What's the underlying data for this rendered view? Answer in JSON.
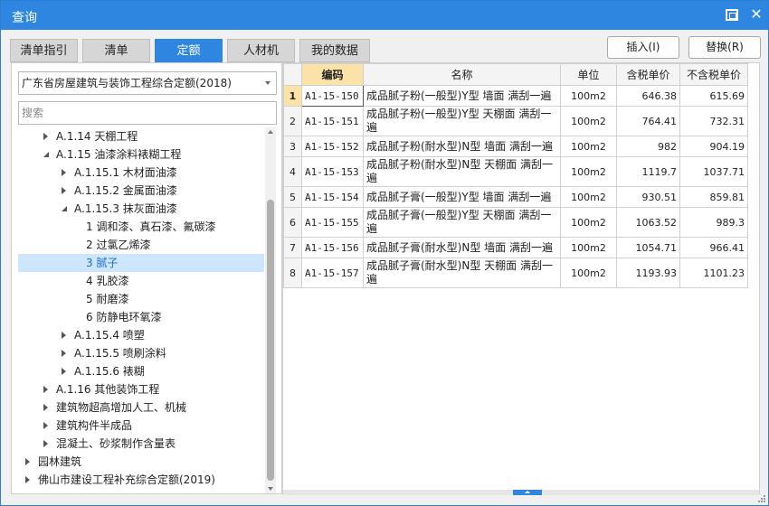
{
  "window": {
    "title": "查询"
  },
  "tabs": [
    {
      "label": "清单指引",
      "active": false
    },
    {
      "label": "清单",
      "active": false
    },
    {
      "label": "定额",
      "active": true
    },
    {
      "label": "人材机",
      "active": false
    },
    {
      "label": "我的数据",
      "active": false
    }
  ],
  "buttons": {
    "insert": "插入(I)",
    "replace": "替换(R)"
  },
  "quota_library": {
    "selected": "广东省房屋建筑与装饰工程综合定额(2018)"
  },
  "search": {
    "placeholder": "搜索",
    "value": ""
  },
  "tree": [
    {
      "label": "A.1.14 天棚工程",
      "level": 1,
      "toggle": "collapsed"
    },
    {
      "label": "A.1.15 油漆涂料裱糊工程",
      "level": 1,
      "toggle": "expanded"
    },
    {
      "label": "A.1.15.1 木材面油漆",
      "level": 2,
      "toggle": "collapsed"
    },
    {
      "label": "A.1.15.2 金属面油漆",
      "level": 2,
      "toggle": "collapsed"
    },
    {
      "label": "A.1.15.3 抹灰面油漆",
      "level": 2,
      "toggle": "expanded"
    },
    {
      "label": "1 调和漆、真石漆、氟碳漆",
      "level": 3,
      "toggle": "none"
    },
    {
      "label": "2 过氯乙烯漆",
      "level": 3,
      "toggle": "none"
    },
    {
      "label": "3 腻子",
      "level": 3,
      "toggle": "none",
      "selected": true
    },
    {
      "label": "4 乳胶漆",
      "level": 3,
      "toggle": "none"
    },
    {
      "label": "5 耐磨漆",
      "level": 3,
      "toggle": "none"
    },
    {
      "label": "6 防静电环氧漆",
      "level": 3,
      "toggle": "none"
    },
    {
      "label": "A.1.15.4 喷塑",
      "level": 2,
      "toggle": "collapsed"
    },
    {
      "label": "A.1.15.5 喷刷涂料",
      "level": 2,
      "toggle": "collapsed"
    },
    {
      "label": "A.1.15.6 裱糊",
      "level": 2,
      "toggle": "collapsed"
    },
    {
      "label": "A.1.16 其他装饰工程",
      "level": 1,
      "toggle": "collapsed"
    },
    {
      "label": "建筑物超高增加人工、机械",
      "level": 1,
      "toggle": "collapsed"
    },
    {
      "label": "建筑构件半成品",
      "level": 1,
      "toggle": "collapsed"
    },
    {
      "label": "混凝土、砂浆制作含量表",
      "level": 1,
      "toggle": "collapsed"
    },
    {
      "label": "园林建筑",
      "level": 0,
      "toggle": "collapsed"
    },
    {
      "label": "佛山市建设工程补充综合定额(2019)",
      "level": 0,
      "toggle": "collapsed"
    }
  ],
  "table": {
    "columns": {
      "code": "编码",
      "name": "名称",
      "unit": "单位",
      "price_tax": "含税单价",
      "price_notax": "不含税单价"
    },
    "rows": [
      {
        "idx": "1",
        "code": "A1-15-150",
        "name": "成品腻子粉(一般型)Y型 墙面 满刮一遍",
        "unit": "100m2",
        "price_tax": "646.38",
        "price_notax": "615.69"
      },
      {
        "idx": "2",
        "code": "A1-15-151",
        "name": "成品腻子粉(一般型)Y型 天棚面 满刮一遍",
        "unit": "100m2",
        "price_tax": "764.41",
        "price_notax": "732.31"
      },
      {
        "idx": "3",
        "code": "A1-15-152",
        "name": "成品腻子粉(耐水型)N型 墙面 满刮一遍",
        "unit": "100m2",
        "price_tax": "982",
        "price_notax": "904.19"
      },
      {
        "idx": "4",
        "code": "A1-15-153",
        "name": "成品腻子粉(耐水型)N型 天棚面 满刮一遍",
        "unit": "100m2",
        "price_tax": "1119.7",
        "price_notax": "1037.71"
      },
      {
        "idx": "5",
        "code": "A1-15-154",
        "name": "成品腻子膏(一般型)Y型 墙面 满刮一遍",
        "unit": "100m2",
        "price_tax": "930.51",
        "price_notax": "859.81"
      },
      {
        "idx": "6",
        "code": "A1-15-155",
        "name": "成品腻子膏(一般型)Y型 天棚面 满刮一遍",
        "unit": "100m2",
        "price_tax": "1063.52",
        "price_notax": "989.3"
      },
      {
        "idx": "7",
        "code": "A1-15-156",
        "name": "成品腻子膏(耐水型)N型 墙面 满刮一遍",
        "unit": "100m2",
        "price_tax": "1054.71",
        "price_notax": "966.41"
      },
      {
        "idx": "8",
        "code": "A1-15-157",
        "name": "成品腻子膏(耐水型)N型 天棚面 满刮一遍",
        "unit": "100m2",
        "price_tax": "1193.93",
        "price_notax": "1101.23"
      }
    ]
  },
  "colors": {
    "accent": "#2f86e0",
    "selected_bg": "#cde6fb",
    "header_highlight": "#fbe3a8"
  }
}
